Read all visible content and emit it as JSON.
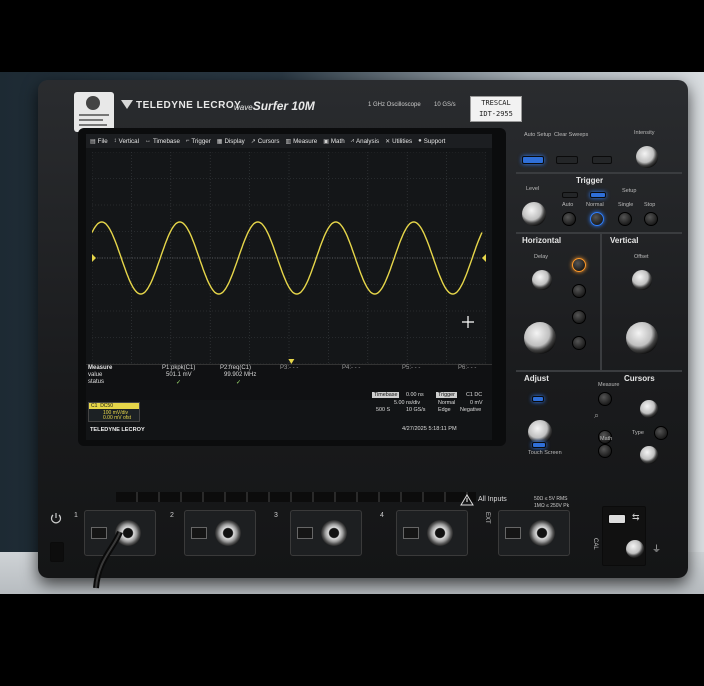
{
  "device": {
    "brand": "TELEDYNE LECROY",
    "model_prefix": "wave",
    "model_name": "Surfer 10M",
    "spec_bandwidth": "1 GHz Oscilloscope",
    "spec_rate": "10 GS/s",
    "calibration_label": {
      "line1": "TRESCAL",
      "line2": "IDT-2955"
    }
  },
  "menu": {
    "items": [
      "File",
      "Vertical",
      "Timebase",
      "Trigger",
      "Display",
      "Cursors",
      "Measure",
      "Math",
      "Analysis",
      "Utilities",
      "Support"
    ]
  },
  "measure": {
    "header": "Measure",
    "row_value": "value",
    "row_status": "status",
    "p1_label": "P1:pkpk(C1)",
    "p1_value": "501.1 mV",
    "p2_label": "P2:freq(C1)",
    "p2_value": "99.902 MHz",
    "p3_label": "P3:- - -",
    "p4_label": "P4:- - -",
    "p5_label": "P5:- - -",
    "p6_label": "P6:- - -"
  },
  "channel": {
    "name": "C1",
    "coupling": "DC50",
    "scale": "100 mV/div",
    "offset": "0.00 mV ofst",
    "color": "#e6d64a"
  },
  "timebase": {
    "header": "Timebase",
    "value": "0.00 ns",
    "scale": "5.00 ns/div",
    "samples": "500 S",
    "rate": "10 GS/s"
  },
  "trigger": {
    "header": "Trigger",
    "chan": "C1",
    "coupling": "DC",
    "mode": "Normal",
    "level": "0 mV",
    "type": "Edge",
    "slope": "Negative"
  },
  "screen_brand": "TELEDYNE LECROY",
  "datetime": "4/27/2025 5:18:11 PM",
  "panel": {
    "auto_setup": "Auto Setup",
    "clear_sweeps": "Clear Sweeps",
    "intensity": "Intensity",
    "trigger": "Trigger",
    "level": "Level",
    "setup": "Setup",
    "auto": "Auto",
    "normal": "Normal",
    "single": "Single",
    "stop": "Stop",
    "horizontal": "Horizontal",
    "vertical": "Vertical",
    "delay": "Delay",
    "offset": "Offset",
    "adjust": "Adjust",
    "cursors": "Cursors",
    "measure": "Measure",
    "type": "Type",
    "math": "Math",
    "touch_screen": "Touch Screen"
  },
  "bottom": {
    "ch_numbers": [
      "1",
      "2",
      "3",
      "4"
    ],
    "ext": "EXT",
    "cal": "CAL",
    "all_inputs": "All Inputs",
    "rating1": "50Ω ≤ 5V RMS",
    "rating2": "1MΩ ≤ 250V Pk"
  },
  "waveform": {
    "cycles_visible": 5,
    "amplitude_divisions": 1.6,
    "color": "#e6d64a"
  }
}
